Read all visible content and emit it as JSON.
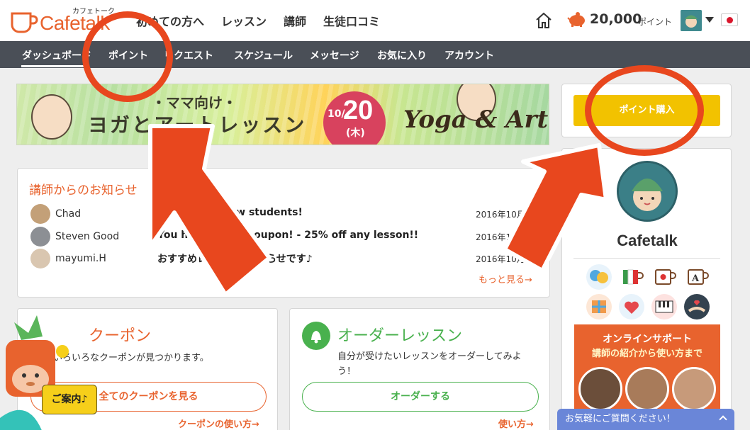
{
  "header": {
    "logo_subtitle": "カフェトーク",
    "logo_text": "Cafetalk",
    "nav": [
      "初めての方へ",
      "レッスン",
      "講師",
      "生徒口コミ"
    ],
    "points_value": "20,000",
    "points_unit": "ポイント"
  },
  "subnav": {
    "items": [
      "ダッシュボード",
      "ポイント",
      "リクエスト",
      "スケジュール",
      "メッセージ",
      "お気に入り",
      "アカウント"
    ],
    "active_index": 0
  },
  "banner": {
    "subtitle": "・ママ向け・",
    "title": "ヨガとアートレッスン",
    "date_month": "10/",
    "date_day": "20",
    "date_dow": "(木)",
    "english": "Yoga & Art"
  },
  "notices": {
    "title": "講師からのお知らせ",
    "rows": [
      {
        "name": "Chad",
        "message": "25% off for new students!",
        "date": "2016年10月"
      },
      {
        "name": "Steven Good",
        "message": "You have a new coupon! - 25% off any lesson!!",
        "date": "2016年10月"
      },
      {
        "name": "mayumi.H",
        "message": "おすすめレッスンのお知らせです♪",
        "date": "2016年10月"
      }
    ],
    "more_link": "もっと見る→"
  },
  "coupon": {
    "title": "クーポン",
    "description": "いろいろなクーポンが見つかります。",
    "button": "全てのクーポンを見る",
    "how_link": "クーポンの使い方→"
  },
  "order_lesson": {
    "title": "オーダーレッスン",
    "description": "自分が受けたいレッスンをオーダーしてみよう！",
    "button": "オーダーする",
    "how_link": "使い方→"
  },
  "sidebar": {
    "buy_points_button": "ポイント購入",
    "profile_name": "Cafetalk",
    "category_icons": [
      "chat-bubbles-icon",
      "italy-flag-cup-icon",
      "japan-flag-cup-icon",
      "letter-a-cup-icon",
      "map-icon",
      "heart-chat-icon",
      "piano-keys-icon",
      "handshake-heart-icon"
    ],
    "support_title": "オンラインサポート",
    "support_subtitle": "講師の紹介から使い方まで"
  },
  "floating": {
    "guide_button": "ご案内♪",
    "chat_bar": "お気軽にご質問ください！"
  },
  "colors": {
    "brand_orange": "#e8632e",
    "nav_dark": "#4a4f57",
    "buy_yellow": "#f2c200",
    "order_green": "#49b14e",
    "annotation_red": "#e8471e"
  }
}
